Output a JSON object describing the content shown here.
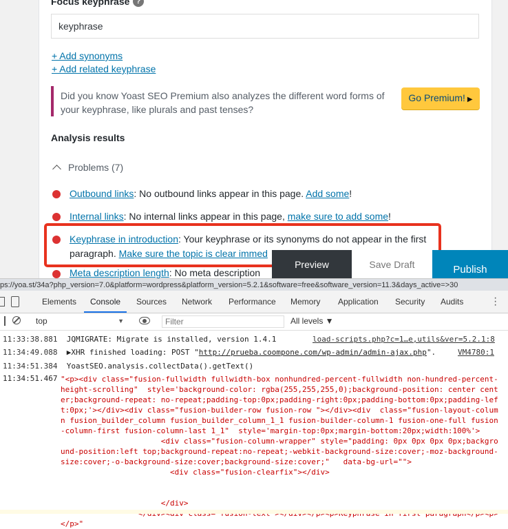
{
  "yoast": {
    "focus_label": "Focus keyphrase",
    "help_icon": "?",
    "keyphrase_value": "keyphrase",
    "add_synonyms": "+ Add synonyms",
    "add_related": "+ Add related keyphrase",
    "premium_text": "Did you know Yoast SEO Premium also analyzes the different word forms of your keyphrase, like plurals and past tenses?",
    "premium_button": "Go Premium!",
    "analysis_title": "Analysis results",
    "problems_label": "Problems (7)",
    "results": [
      {
        "link": "Outbound links",
        "text": ": No outbound links appear in this page. ",
        "action": "Add some",
        "tail": "!"
      },
      {
        "link": "Internal links",
        "text": ": No internal links appear in this page, ",
        "action": "make sure to add some",
        "tail": "!"
      },
      {
        "link": "Keyphrase in introduction",
        "text": ": Your keyphrase or its synonyms do not appear in the first paragraph. ",
        "action": "Make sure the topic is clear immed",
        "tail": ""
      },
      {
        "link": "Meta description length",
        "text": ": No meta description",
        "action": "",
        "tail": ""
      }
    ],
    "preview_button": "Preview",
    "draft_button": "Save Draft",
    "publish_button": "Publish",
    "status_url": "ps://yoa.st/34a?php_version=7.0&platform=wordpress&platform_version=5.2.1&software=free&software_version=11.3&days_active=>30"
  },
  "devtools": {
    "tabs": [
      "Elements",
      "Console",
      "Sources",
      "Network",
      "Performance",
      "Memory",
      "Application",
      "Security",
      "Audits"
    ],
    "active_tab": "Console",
    "context": "top",
    "filter_placeholder": "Filter",
    "levels": "All levels ▼",
    "logs": [
      {
        "time": "11:33:38.881",
        "msg": "JQMIGRATE: Migrate is installed, version 1.4.1",
        "source": "load-scripts.php?c=1…e,utils&ver=5.2.1:8"
      },
      {
        "time": "11:34:49.088",
        "msg": "▶XHR finished loading: POST \"",
        "url": "http://prueba.coompone.com/wp-admin/admin-ajax.php",
        "after": "\".",
        "source": "VM4780:1"
      },
      {
        "time": "11:34:51.384",
        "msg": "YoastSEO.analysis.collectData().getText()"
      },
      {
        "time": "11:34:51.467",
        "string": "\"<p><div class=\"fusion-fullwidth fullwidth-box nonhundred-percent-fullwidth non-hundred-percent-height-scrolling\"  style='background-color: rgba(255,255,255,0);background-position: center center;background-repeat: no-repeat;padding-top:0px;padding-right:0px;padding-bottom:0px;padding-left:0px;'></div><div class=\"fusion-builder-row fusion-row \"></div><div  class=\"fusion-layout-column fusion_builder_column fusion_builder_column_1_1 fusion-builder-column-1 fusion-one-full fusion-column-first fusion-column-last 1_1\"  style='margin-top:0px;margin-bottom:20px;width:100%'>\n                      <div class=\"fusion-column-wrapper\" style=\"padding: 0px 0px 0px 0px;background-position:left top;background-repeat:no-repeat;-webkit-background-size:cover;-moz-background-size:cover;-o-background-size:cover;background-size:cover;\"   data-bg-url=\"\">\n                        <div class=\"fusion-clearfix\"></div>\n\n\n                      </div>\n                 </div><div class=\"fusion-text\"></div></p><p>Keyphrase in first paragraph</p><p></p>\""
      }
    ]
  }
}
